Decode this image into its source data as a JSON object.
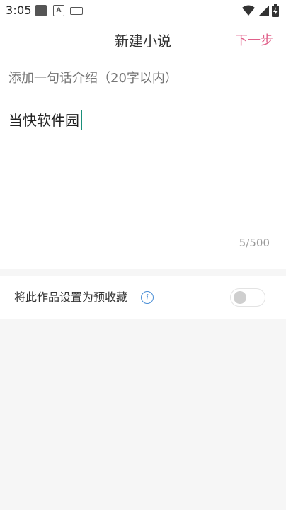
{
  "status_bar": {
    "time": "3:05",
    "icons": [
      "square-icon",
      "a-box-icon",
      "keyboard-icon",
      "wifi-icon",
      "signal-icon",
      "battery-icon"
    ]
  },
  "header": {
    "title": "新建小说",
    "next_label": "下一步"
  },
  "editor": {
    "intro_placeholder": "添加一句话介绍（20字以内）",
    "body_text": "当快软件园",
    "char_count": "5/500"
  },
  "settings": {
    "pre_collect_label": "将此作品设置为预收藏",
    "info_glyph": "i",
    "pre_collect_enabled": false
  },
  "colors": {
    "accent": "#e0608a",
    "cursor": "#1a8f7a",
    "info": "#4a8ed6"
  }
}
